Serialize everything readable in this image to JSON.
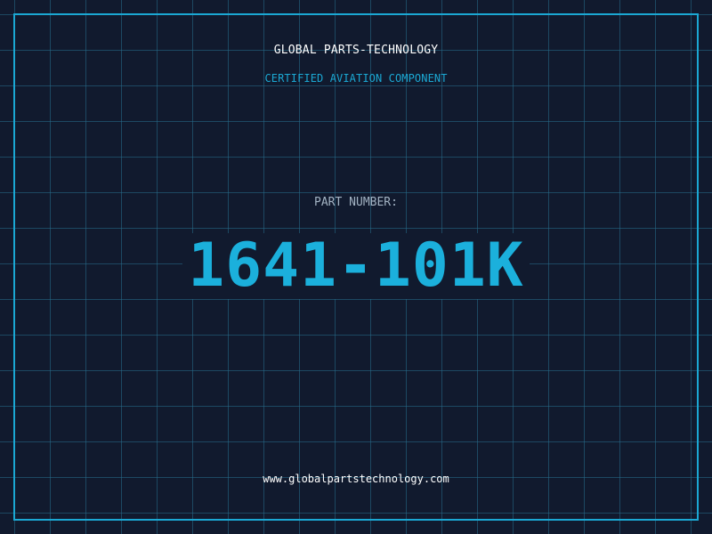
{
  "header": {
    "company_name": "GLOBAL PARTS-TECHNOLOGY",
    "tagline": "CERTIFIED AVIATION COMPONENT"
  },
  "part": {
    "label": "PART NUMBER:",
    "number": "1641-101K"
  },
  "footer": {
    "website": "www.globalpartstechnology.com"
  },
  "colors": {
    "background": "#111a2e",
    "accent": "#1bb0dc",
    "grid": "#266e8c",
    "text": "#ffffff",
    "label": "#a3b3c3"
  }
}
